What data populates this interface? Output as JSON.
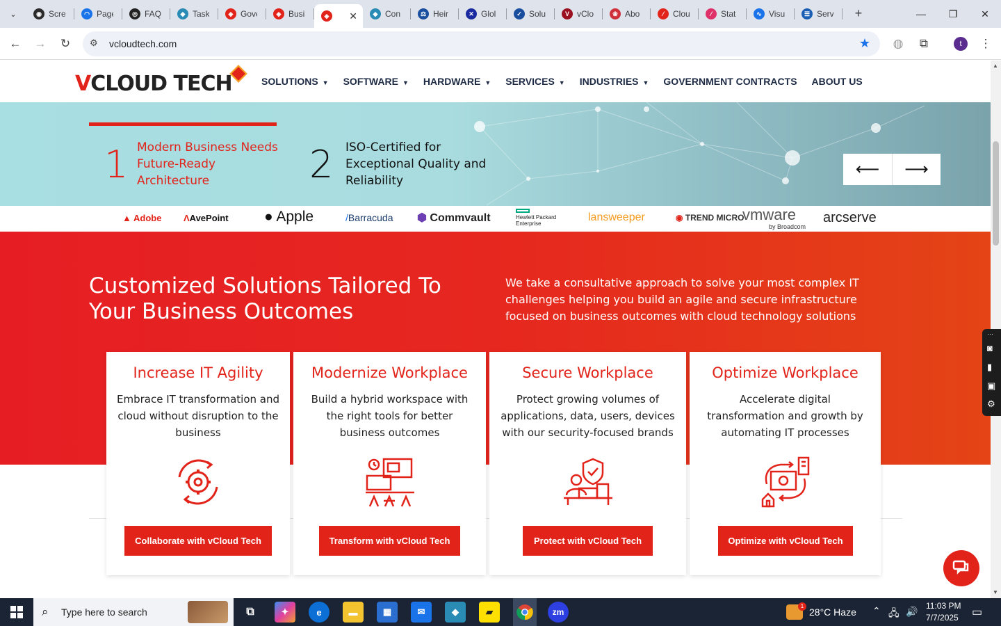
{
  "browser": {
    "tabs": [
      {
        "label": "Scre",
        "color": "#2b2b2b",
        "glyph": "◉"
      },
      {
        "label": "Page",
        "color": "#1a73e8",
        "glyph": "◠"
      },
      {
        "label": "FAQ",
        "color": "#222222",
        "glyph": "◎"
      },
      {
        "label": "Task",
        "color": "#2a8bb5",
        "glyph": "◆"
      },
      {
        "label": "Gove",
        "color": "#e2231a",
        "glyph": "◈"
      },
      {
        "label": "Busi",
        "color": "#e2231a",
        "glyph": "◈"
      },
      {
        "label": "",
        "color": "#e2231a",
        "glyph": "◈",
        "active": true
      },
      {
        "label": "Con",
        "color": "#2a8bb5",
        "glyph": "◆"
      },
      {
        "label": "Heir",
        "color": "#1a4fa0",
        "glyph": "⚖"
      },
      {
        "label": "Glol",
        "color": "#1a2ba0",
        "glyph": "✕"
      },
      {
        "label": "Solu",
        "color": "#1a4fa0",
        "glyph": "✓"
      },
      {
        "label": "vClo",
        "color": "#9a1020",
        "glyph": "V"
      },
      {
        "label": "Abo",
        "color": "#d0303a",
        "glyph": "❀"
      },
      {
        "label": "Clou",
        "color": "#e2231a",
        "glyph": "⁄"
      },
      {
        "label": "Stat",
        "color": "#e0306a",
        "glyph": "⁄"
      },
      {
        "label": "Visu",
        "color": "#1a73e8",
        "glyph": "∿"
      },
      {
        "label": "Serv",
        "color": "#1a5fb4",
        "glyph": "☰"
      }
    ],
    "close_tab": "✕",
    "new_tab": "+",
    "url": "vcloudtech.com",
    "profile_initial": "t"
  },
  "site": {
    "logo_v": "V",
    "logo_cloud": "CLOUD",
    "logo_tech": "TECH",
    "nav": [
      {
        "label": "SOLUTIONS",
        "dropdown": true
      },
      {
        "label": "SOFTWARE",
        "dropdown": true
      },
      {
        "label": "HARDWARE",
        "dropdown": true
      },
      {
        "label": "SERVICES",
        "dropdown": true
      },
      {
        "label": "INDUSTRIES",
        "dropdown": true
      },
      {
        "label": "GOVERNMENT CONTRACTS",
        "dropdown": false
      },
      {
        "label": "ABOUT US",
        "dropdown": false
      }
    ],
    "hero": {
      "step1_num": "1",
      "step1_text": "Modern Business Needs Future-Ready Architecture",
      "step2_num": "2",
      "step2_text": "ISO-Certified for Exceptional Quality and Reliability",
      "prev_arrow": "⟵",
      "next_arrow": "⟶"
    },
    "brands": [
      "Adobe",
      "AvePoint",
      "Apple",
      "Barracuda",
      "Commvault",
      "Hewlett Packard Enterprise",
      "lansweeper",
      "TREND MICRO",
      "vmware",
      "by Broadcom",
      "arcserve"
    ],
    "section": {
      "title": "Customized Solutions Tailored To Your Business Outcomes",
      "description": "We take a consultative approach to solve your most complex IT challenges helping you build an agile and secure infrastructure focused on business outcomes with cloud technology solutions"
    },
    "cards": [
      {
        "title": "Increase IT Agility",
        "text": "Embrace IT transformation and cloud without disruption to the business",
        "button": "Collaborate with vCloud Tech"
      },
      {
        "title": "Modernize Workplace",
        "text": "Build a hybrid workspace with the right tools for better business outcomes",
        "button": "Transform with vCloud Tech"
      },
      {
        "title": "Secure Workplace",
        "text": "Protect growing volumes of applications, data, users, devices with our security-focused brands",
        "button": "Protect with vCloud Tech"
      },
      {
        "title": "Optimize Workplace",
        "text": "Accelerate digital transformation and growth by automating IT processes",
        "button": "Optimize with vCloud Tech"
      }
    ],
    "brand_color": "#e2231a"
  },
  "taskbar": {
    "search_placeholder": "Type here to search",
    "weather": "28°C  Haze",
    "time": "11:03 PM",
    "date": "7/7/2025",
    "weather_badge": "1"
  }
}
